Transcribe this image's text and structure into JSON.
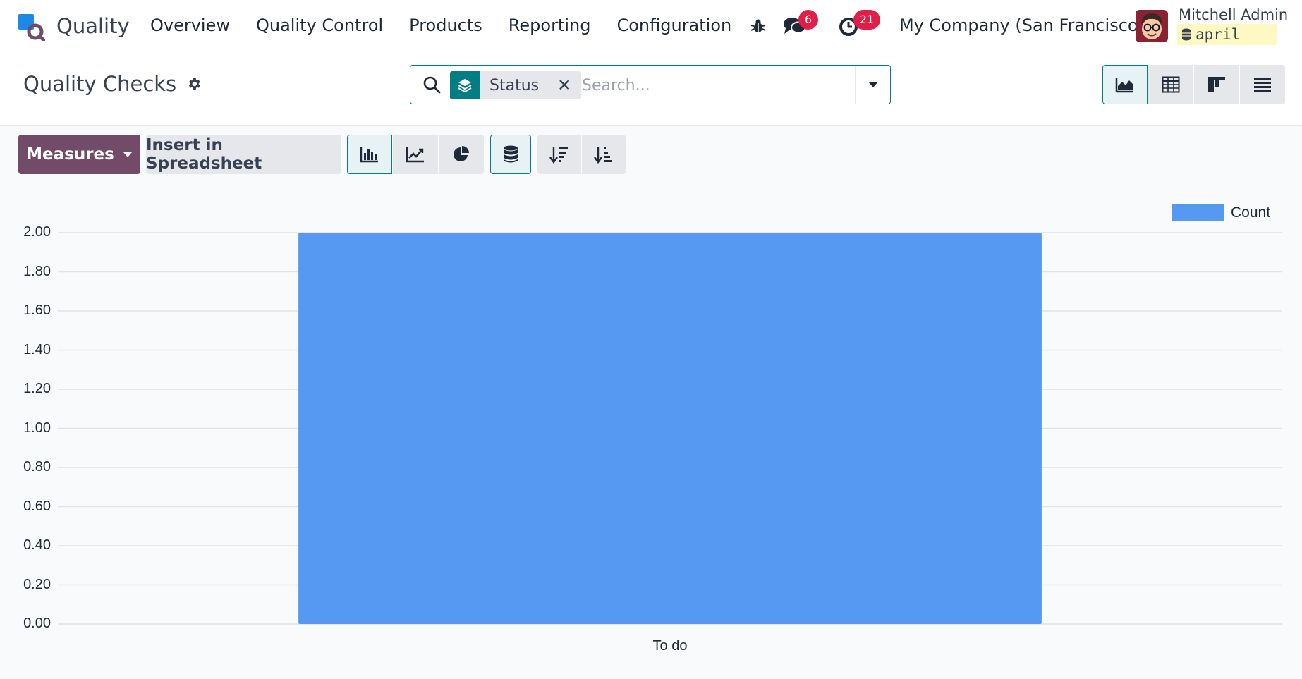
{
  "app": {
    "name": "Quality"
  },
  "nav": {
    "menu": [
      "Overview",
      "Quality Control",
      "Products",
      "Reporting",
      "Configuration"
    ],
    "chat_count": "6",
    "activity_count": "21",
    "company": "My Company (San Francisco)",
    "user_name": "Mitchell Admin",
    "db_name": "april"
  },
  "control": {
    "title": "Quality Checks",
    "facet_label": "Status",
    "search_placeholder": "Search..."
  },
  "toolbar": {
    "measures_label": "Measures",
    "insert_label": "Insert in Spreadsheet"
  },
  "colors": {
    "brand": "#714b67",
    "accent": "#017e84",
    "bar": "#5599f2",
    "badge": "#e11d48"
  },
  "chart_data": {
    "type": "bar",
    "categories": [
      "To do"
    ],
    "series": [
      {
        "name": "Count",
        "values": [
          2
        ]
      }
    ],
    "ylim": [
      0,
      2
    ],
    "yticks": [
      "0.00",
      "0.20",
      "0.40",
      "0.60",
      "0.80",
      "1.00",
      "1.20",
      "1.40",
      "1.60",
      "1.80",
      "2.00"
    ],
    "grid": true,
    "legend": "top-right"
  }
}
